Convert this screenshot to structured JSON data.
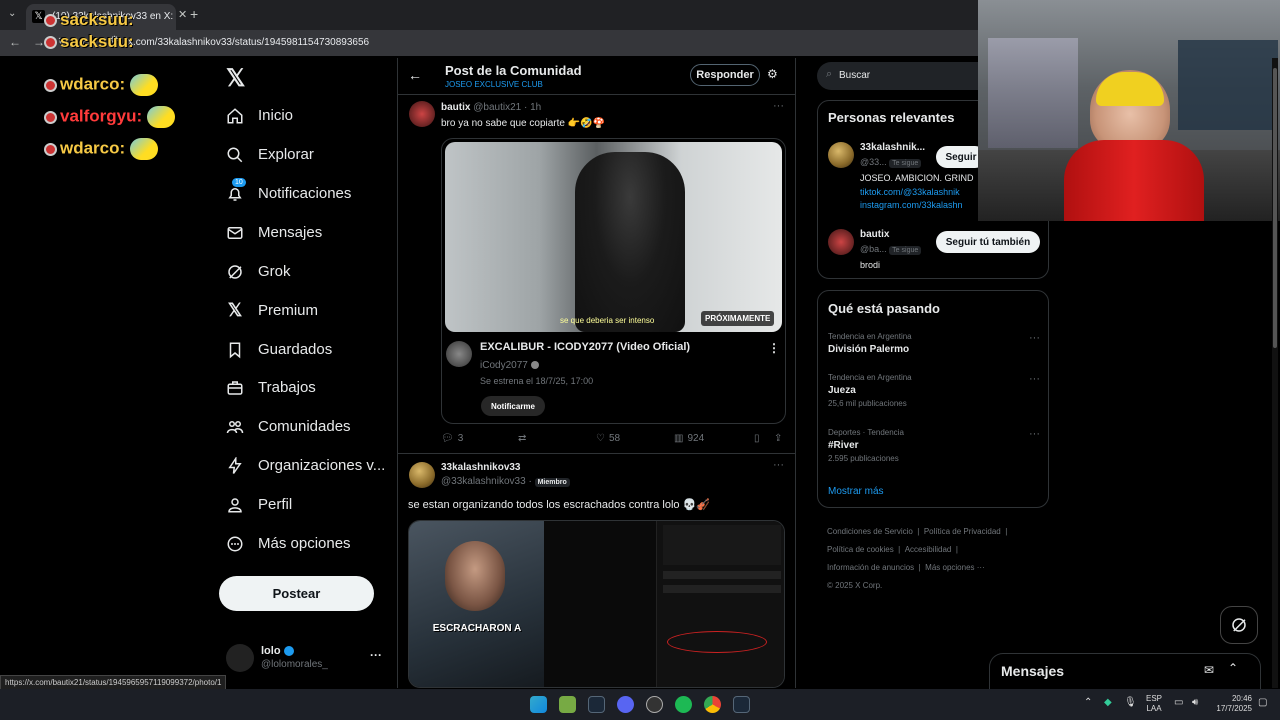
{
  "browser": {
    "tab_title": "(10) 33kalashnikov33 en X: \"@...",
    "url": "x.com/33kalashnikov33/status/1945981154730893656",
    "status_url": "https://x.com/bautix21/status/1945965957119099372/photo/1"
  },
  "chat_overlay": [
    {
      "user": "sacksuu:",
      "color": "#f6c945"
    },
    {
      "user": "sacksuu:",
      "color": "#f6c945"
    },
    {
      "user": "wdarco:",
      "color": "#f6c945"
    },
    {
      "user": "valforgyu:",
      "color": "#ff3b3b"
    },
    {
      "user": "wdarco:",
      "color": "#f6c945"
    }
  ],
  "sidebar": {
    "logo": "x-logo",
    "notif_badge": "10",
    "items": [
      {
        "label": "Inicio",
        "icon": "home-icon"
      },
      {
        "label": "Explorar",
        "icon": "search-icon"
      },
      {
        "label": "Notificaciones",
        "icon": "bell-icon"
      },
      {
        "label": "Mensajes",
        "icon": "mail-icon"
      },
      {
        "label": "Grok",
        "icon": "grok-icon"
      },
      {
        "label": "Premium",
        "icon": "x-premium-icon"
      },
      {
        "label": "Guardados",
        "icon": "bookmark-icon"
      },
      {
        "label": "Trabajos",
        "icon": "briefcase-icon"
      },
      {
        "label": "Comunidades",
        "icon": "people-icon"
      },
      {
        "label": "Organizaciones v...",
        "icon": "lightning-icon"
      },
      {
        "label": "Perfil",
        "icon": "person-icon"
      },
      {
        "label": "Más opciones",
        "icon": "more-circle-icon"
      }
    ],
    "post_button": "Postear",
    "account": {
      "name": "lolo",
      "handle": "@lolomorales_",
      "more": "···"
    }
  },
  "header": {
    "title": "Post de la Comunidad",
    "subtitle": "JOSEO EXCLUSIVE CLUB",
    "reply_button": "Responder"
  },
  "post1": {
    "author": "bautix",
    "handle": "@bautix21",
    "time": "· 1h",
    "text": "bro ya no sabe que copiarte 👉🤣🍄",
    "video_caption": "se que deberia ser intenso",
    "badge": "PRÓXIMAMENTE",
    "card_title": "EXCALIBUR - ICODY2077 (Video Oficial)",
    "card_channel": "iCody2077",
    "card_date": "Se estrena el 18/7/25, 17:00",
    "card_button": "Notificarme",
    "replies": "3",
    "retweets": "",
    "likes": "58",
    "views": "924"
  },
  "post2": {
    "author": "33kalashnikov33",
    "handle": "@33kalashnikov33",
    "badge": "Miembro",
    "text": "se estan organizando todos los escrachados contra lolo 💀🎻",
    "image_caption": "ESCRACHARON A"
  },
  "right": {
    "search_placeholder": "Buscar",
    "relevant_title": "Personas relevantes",
    "people": [
      {
        "name": "33kalashnik...",
        "handle": "@33...",
        "follows": "Te sigue",
        "button": "Seguir",
        "bio1": "JOSEO. AMBICION. GRIND",
        "bio2": "tiktok.com/@33kalashnik",
        "bio3": "instagram.com/33kalashn"
      },
      {
        "name": "bautix",
        "handle": "@ba...",
        "follows": "Te sigue",
        "button": "Seguir tú también",
        "bio1": "brodi"
      }
    ],
    "trending_title": "Qué está pasando",
    "trends": [
      {
        "context": "Tendencia en Argentina",
        "name": "División Palermo",
        "count": ""
      },
      {
        "context": "Tendencia en Argentina",
        "name": "Jueza",
        "count": "25,6 mil publicaciones"
      },
      {
        "context": "Deportes · Tendencia",
        "name": "#River",
        "count": "2.595 publicaciones"
      }
    ],
    "show_more": "Mostrar más",
    "footer": [
      "Condiciones de Servicio",
      "Política de Privacidad",
      "Política de cookies",
      "Accesibilidad",
      "Información de anuncios",
      "Más opciones ···",
      "© 2025 X Corp."
    ]
  },
  "messages": {
    "title": "Mensajes"
  },
  "taskbar": {
    "lang1": "ESP",
    "lang2": "LAA",
    "time": "20:46",
    "date": "17/7/2025"
  }
}
